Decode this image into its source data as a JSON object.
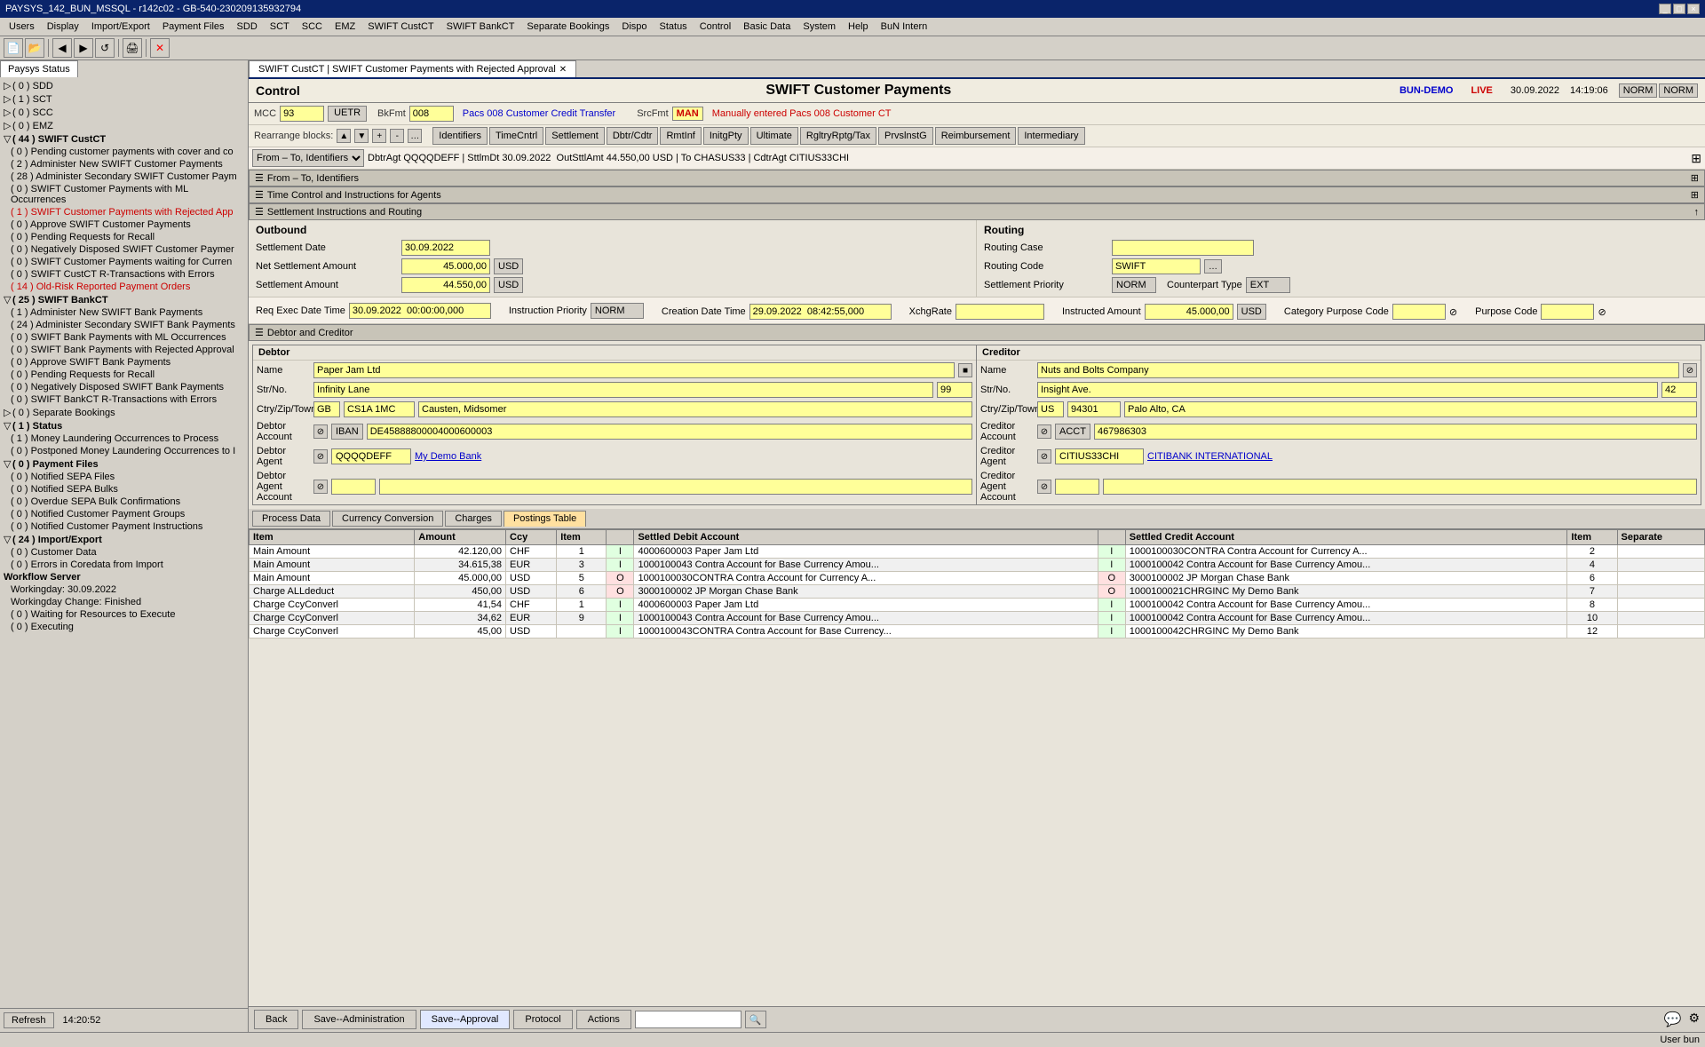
{
  "titleBar": {
    "title": "PAYSYS_142_BUN_MSSQL - r142c02 - GB-540-230209135932794",
    "controls": [
      "_",
      "□",
      "×"
    ]
  },
  "menuBar": {
    "items": [
      "Users",
      "Display",
      "Import/Export",
      "Payment Files",
      "SDD",
      "SCT",
      "SCC",
      "EMZ",
      "SWIFT CustCT",
      "SWIFT BankCT",
      "Separate Bookings",
      "Dispo",
      "Status",
      "Control",
      "Basic Data",
      "System",
      "Help",
      "BuN Intern"
    ]
  },
  "tabs": {
    "paysysStatus": "Paysys Status",
    "swiftTab": "SWIFT CustCT | SWIFT Customer Payments with Rejected Approval"
  },
  "sidebar": {
    "refreshBtn": "Refresh",
    "time": "14:20:52",
    "groups": [
      {
        "label": "( 0 ) SDD",
        "indent": 0,
        "type": "normal"
      },
      {
        "label": "( 1 ) SCT",
        "indent": 0,
        "type": "normal"
      },
      {
        "label": "( 0 ) SCC",
        "indent": 0,
        "type": "normal"
      },
      {
        "label": "( 0 ) EMZ",
        "indent": 0,
        "type": "normal"
      },
      {
        "label": "( 44 ) SWIFT CustCT",
        "indent": 0,
        "type": "normal",
        "expanded": true
      },
      {
        "label": "( 0 ) Pending customer payments with cover and co",
        "indent": 1,
        "type": "normal"
      },
      {
        "label": "( 2 ) Administer New SWIFT Customer Payments",
        "indent": 1,
        "type": "normal"
      },
      {
        "label": "( 28 ) Administer Secondary SWIFT Customer Paym",
        "indent": 1,
        "type": "normal"
      },
      {
        "label": "( 0 ) SWIFT Customer Payments with ML Occurrences",
        "indent": 1,
        "type": "normal"
      },
      {
        "label": "( 1 ) SWIFT Customer Payments with Rejected App",
        "indent": 1,
        "type": "red"
      },
      {
        "label": "( 0 ) Approve SWIFT Customer Payments",
        "indent": 1,
        "type": "normal"
      },
      {
        "label": "( 0 ) Pending Requests for Recall",
        "indent": 1,
        "type": "normal"
      },
      {
        "label": "( 0 ) Negatively Disposed SWIFT Customer Paymer",
        "indent": 1,
        "type": "normal"
      },
      {
        "label": "( 0 ) SWIFT Customer Payments waiting for Curren",
        "indent": 1,
        "type": "normal"
      },
      {
        "label": "( 0 ) SWIFT CustCT R-Transactions with Errors",
        "indent": 1,
        "type": "normal"
      },
      {
        "label": "( 14 ) Old-Risk Reported Payment Orders",
        "indent": 1,
        "type": "red"
      },
      {
        "label": "( 25 ) SWIFT BankCT",
        "indent": 0,
        "type": "normal",
        "expanded": true
      },
      {
        "label": "( 1 ) Administer New SWIFT Bank Payments",
        "indent": 1,
        "type": "normal"
      },
      {
        "label": "( 24 ) Administer Secondary SWIFT Bank Payments",
        "indent": 1,
        "type": "normal"
      },
      {
        "label": "( 0 ) SWIFT Bank Payments with ML Occurrences",
        "indent": 1,
        "type": "normal"
      },
      {
        "label": "( 0 ) SWIFT Bank Payments with Rejected Approval",
        "indent": 1,
        "type": "normal"
      },
      {
        "label": "( 0 ) Approve SWIFT Bank Payments",
        "indent": 1,
        "type": "normal"
      },
      {
        "label": "( 0 ) Pending Requests for Recall",
        "indent": 1,
        "type": "normal"
      },
      {
        "label": "( 0 ) Negatively Disposed SWIFT Bank Payments",
        "indent": 1,
        "type": "normal"
      },
      {
        "label": "( 0 ) SWIFT BankCT R-Transactions with Errors",
        "indent": 1,
        "type": "normal"
      },
      {
        "label": "( 0 ) Separate Bookings",
        "indent": 0,
        "type": "normal"
      },
      {
        "label": "( 1 ) Status",
        "indent": 0,
        "type": "normal",
        "expanded": true
      },
      {
        "label": "( 1 ) Money Laundering Occurrences to Process",
        "indent": 1,
        "type": "normal"
      },
      {
        "label": "( 0 ) Postponed Money Laundering Occurrences to I",
        "indent": 1,
        "type": "normal"
      },
      {
        "label": "( 0 ) Payment Files",
        "indent": 0,
        "type": "normal",
        "expanded": true
      },
      {
        "label": "( 0 ) Notified SEPA Files",
        "indent": 1,
        "type": "normal"
      },
      {
        "label": "( 0 ) Notified SEPA Bulks",
        "indent": 1,
        "type": "normal"
      },
      {
        "label": "( 0 ) Overdue SEPA Bulk Confirmations",
        "indent": 1,
        "type": "normal"
      },
      {
        "label": "( 0 ) Notified Customer Payment Groups",
        "indent": 1,
        "type": "normal"
      },
      {
        "label": "( 0 ) Notified Customer Payment Instructions",
        "indent": 1,
        "type": "normal"
      },
      {
        "label": "( 24 ) Import/Export",
        "indent": 0,
        "type": "normal",
        "expanded": true
      },
      {
        "label": "( 0 ) Customer Data",
        "indent": 1,
        "type": "normal"
      },
      {
        "label": "( 0 ) Errors in Coredata from Import",
        "indent": 1,
        "type": "normal"
      },
      {
        "label": "Workflow Server",
        "indent": 0,
        "type": "bold"
      },
      {
        "label": "Workingday: 30.09.2022",
        "indent": 1,
        "type": "normal"
      },
      {
        "label": "Workingday Change: Finished",
        "indent": 1,
        "type": "normal"
      },
      {
        "label": "( 0 ) Waiting for Resources to Execute",
        "indent": 1,
        "type": "normal"
      },
      {
        "label": "( 0 ) Executing",
        "indent": 1,
        "type": "normal"
      }
    ]
  },
  "header": {
    "controlLabel": "Control",
    "titleMain": "SWIFT Customer Payments",
    "systemName": "BUN-DEMO",
    "liveLabel": "LIVE",
    "date": "30.09.2022",
    "time": "14:19:06",
    "normLabel1": "NORM",
    "normLabel2": "NORM"
  },
  "topForm": {
    "mccLabel": "MCC",
    "mccValue": "93",
    "uetrLabel": "UETR",
    "bkfmtLabel": "BkFmt",
    "bkfmtValue": "008",
    "pacsValue": "Pacs 008  Customer Credit Transfer",
    "srcfmtLabel": "SrcFmt",
    "srcfmtValue": "MAN",
    "srcfmtDesc": "Manually entered Pacs 008 Customer CT",
    "rearrangeLabel": "Rearrange blocks:"
  },
  "toolbarButtons": [
    "Identifiers",
    "TimeCntrl",
    "Settlement",
    "Dbtr/Cdtr",
    "RmtInf",
    "InitgPty",
    "Ultimate",
    "RgltryRptg/Tax",
    "PrvslnstG",
    "Reimbursement",
    "Intermediary"
  ],
  "fromToRow": {
    "label": "From – To, Identifiers",
    "value": "DbtrAgt QQQQDEFF | SttlmDt 30.09.2022  OutSttlAmt 44.550,00 USD | To CHASUS33 | CdtrAgt CITIUS33CHI"
  },
  "sections": [
    {
      "label": "From – To, Identifiers"
    },
    {
      "label": "Time Control and Instructions for Agents"
    },
    {
      "label": "Settlement Instructions and Routing"
    }
  ],
  "outbound": {
    "title": "Outbound",
    "settlementDateLabel": "Settlement Date",
    "settlementDateValue": "30.09.2022",
    "netSettlementLabel": "Net Settlement Amount",
    "netSettlementValue": "45.000,00",
    "netSettlementCcy": "USD",
    "settlementAmountLabel": "Settlement Amount",
    "settlementAmountValue": "44.550,00",
    "settlementAmountCcy": "USD"
  },
  "routing": {
    "title": "Routing",
    "routingCaseLabel": "Routing Case",
    "routingCodeLabel": "Routing Code",
    "routingCodeValue": "SWIFT",
    "settlementPriorityLabel": "Settlement Priority",
    "settlementPriorityValue": "NORM",
    "counterpartTypeLabel": "Counterpart Type",
    "counterpartTypeValue": "EXT"
  },
  "requestFields": {
    "reqExecLabel": "Req Exec Date Time",
    "reqExecValue": "30.09.2022  00:00:00,000",
    "instrPriorityLabel": "Instruction Priority",
    "instrPriorityValue": "NORM",
    "creationLabel": "Creation Date Time",
    "creationValue": "29.09.2022  08:42:55,000",
    "xchgRateLabel": "XchgRate",
    "instrAmtLabel": "Instructed Amount",
    "instrAmtValue": "45.000,00",
    "instrAmtCcy": "USD",
    "catPurposeLabel": "Category Purpose Code",
    "purposeLabel": "Purpose Code"
  },
  "debtorCreditor": {
    "sectionLabel": "Debtor and Creditor",
    "debtor": {
      "title": "Debtor",
      "nameLabel": "Name",
      "nameValue": "Paper Jam Ltd",
      "strNoLabel": "Str/No.",
      "strNoValue": "Infinity Lane",
      "strNoNum": "99",
      "ctryZipLabel": "Ctry/Zip/Town",
      "ctryValue": "GB",
      "zipValue": "CS1A 1MC",
      "townValue": "Causten, Midsomer",
      "accountLabel": "Debtor Account",
      "ibanLabel": "IBAN",
      "ibanValue": "DE45888800004000600003",
      "agentLabel": "Debtor Agent",
      "agentCode": "QQQQDEFF",
      "agentName": "My Demo Bank",
      "agentAccountLabel": "Debtor Agent Account"
    },
    "creditor": {
      "title": "Creditor",
      "nameLabel": "Name",
      "nameValue": "Nuts and Bolts Company",
      "strNoLabel": "Str/No.",
      "strNoValue": "Insight Ave.",
      "strNoNum": "42",
      "ctryZipLabel": "Ctry/Zip/Town",
      "ctryValue": "US",
      "zipValue": "94301",
      "townValue": "Palo Alto, CA",
      "accountLabel": "Creditor Account",
      "acctLabel": "ACCT",
      "acctValue": "467986303",
      "agentLabel": "Creditor Agent",
      "agentCode": "CITIUS33CHI",
      "agentName": "CITIBANK INTERNATIONAL",
      "agentAccountLabel": "Creditor Agent Account"
    }
  },
  "bottomTabs": [
    "Process Data",
    "Currency Conversion",
    "Charges",
    "Postings Table"
  ],
  "activeBottomTab": "Postings Table",
  "postingsTable": {
    "columns": [
      "Item",
      "Amount",
      "Ccy",
      "Item",
      "Settled Debit Account",
      "",
      "Settled Credit Account",
      "",
      "Item",
      "Separate"
    ],
    "rows": [
      {
        "item": "Main Amount",
        "amount": "42.120,00",
        "ccy": "CHF",
        "item2": "1",
        "io1": "I",
        "debitAccount": "4000600003 Paper Jam Ltd",
        "io2": "I",
        "creditAccount": "1000100030CONTRA Contra Account for Currency A...",
        "item3": "2",
        "separate": ""
      },
      {
        "item": "Main Amount",
        "amount": "34.615,38",
        "ccy": "EUR",
        "item2": "3",
        "io1": "I",
        "debitAccount": "1000100043 Contra Account for Base Currency Amou...",
        "io2": "I",
        "creditAccount": "1000100042 Contra Account for Base Currency Amou...",
        "item3": "4",
        "separate": ""
      },
      {
        "item": "Main Amount",
        "amount": "45.000,00",
        "ccy": "USD",
        "item2": "5",
        "io1": "O",
        "debitAccount": "1000100030CONTRA Contra Account for Currency A...",
        "io2": "O",
        "creditAccount": "3000100002 JP Morgan Chase Bank",
        "item3": "6",
        "separate": ""
      },
      {
        "item": "Charge ALLdeduct",
        "amount": "450,00",
        "ccy": "USD",
        "item2": "6",
        "io1": "O",
        "debitAccount": "3000100002 JP Morgan Chase Bank",
        "io2": "O",
        "creditAccount": "1000100021CHRGINC My Demo Bank",
        "item3": "7",
        "separate": ""
      },
      {
        "item": "Charge CcyConverl",
        "amount": "41,54",
        "ccy": "CHF",
        "item2": "1",
        "io1": "I",
        "debitAccount": "4000600003 Paper Jam Ltd",
        "io2": "I",
        "creditAccount": "1000100042 Contra Account for Base Currency Amou...",
        "item3": "8",
        "separate": ""
      },
      {
        "item": "Charge CcyConverl",
        "amount": "34,62",
        "ccy": "EUR",
        "item2": "9",
        "io1": "I",
        "debitAccount": "1000100043 Contra Account for Base Currency Amou...",
        "io2": "I",
        "creditAccount": "1000100042 Contra Account for Base Currency Amou...",
        "item3": "10",
        "separate": ""
      },
      {
        "item": "Charge CcyConverl",
        "amount": "45,00",
        "ccy": "USD",
        "item2": "",
        "io1": "I",
        "debitAccount": "1000100043CONTRA Contra Account for Base Currency...",
        "io2": "I",
        "creditAccount": "1000100042CHRGINC My Demo Bank",
        "item3": "12",
        "separate": ""
      }
    ]
  },
  "bottomBar": {
    "backBtn": "Back",
    "saveAdminBtn": "Save--Administration",
    "saveApprovalBtn": "Save--Approval",
    "protocolBtn": "Protocol",
    "actionsBtn": "Actions"
  },
  "statusBar": {
    "userLabel": "User bun"
  }
}
